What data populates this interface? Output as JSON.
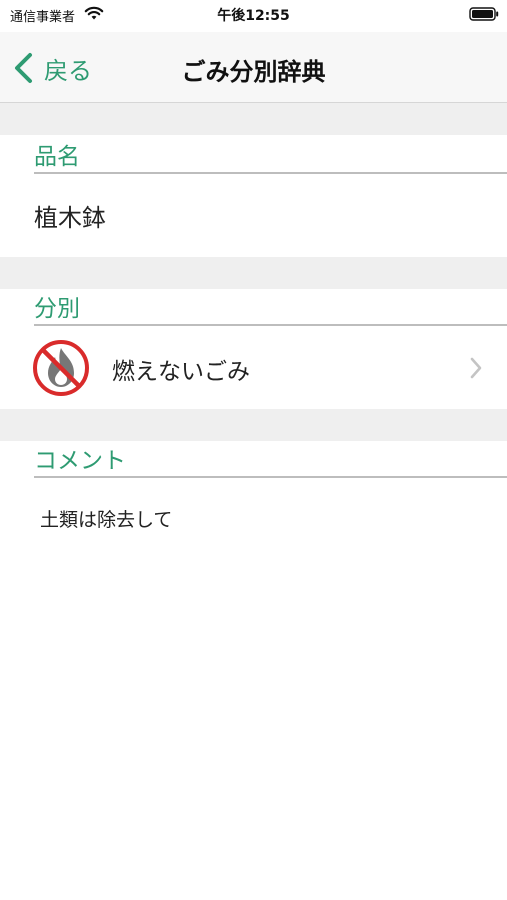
{
  "status_bar": {
    "carrier": "通信事業者",
    "time": "午後12:55"
  },
  "nav": {
    "back_label": "戻る",
    "title": "ごみ分別辞典"
  },
  "sections": {
    "name": {
      "header": "品名",
      "value": "植木鉢"
    },
    "category": {
      "header": "分別",
      "value": "燃えないごみ",
      "icon": "no-burn-icon"
    },
    "comment": {
      "header": "コメント",
      "value": "土類は除去して"
    }
  },
  "colors": {
    "accent": "#2e9b72",
    "separator": "#efefef",
    "prohibition": "#d92b2b"
  }
}
